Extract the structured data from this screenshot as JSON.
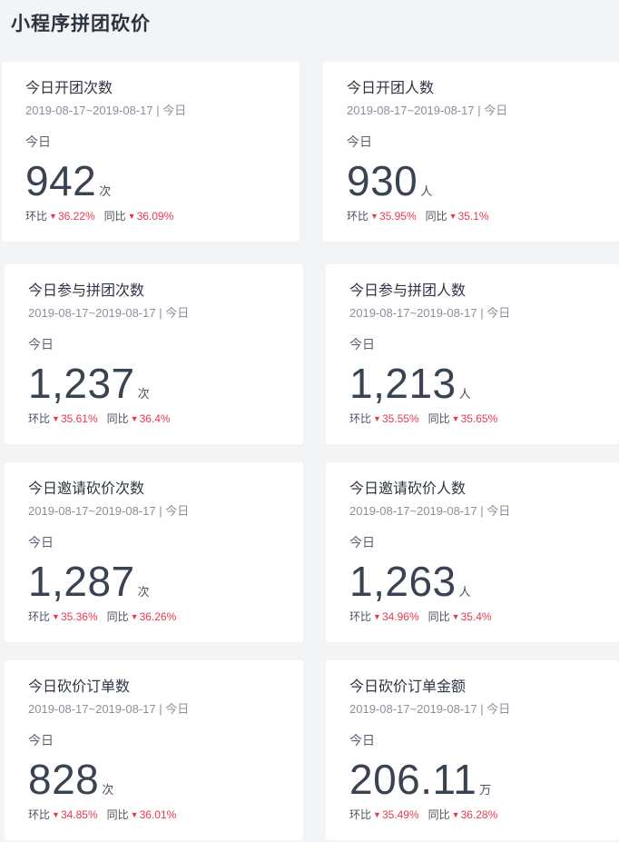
{
  "page": {
    "title": "小程序拼团砍价"
  },
  "colors": {
    "decrease": "#e8384f",
    "background": "#f3f4f6",
    "card": "#ffffff"
  },
  "cards": [
    {
      "title": "今日开团次数",
      "range": "2019-08-17~2019-08-17 | 今日",
      "period": "今日",
      "value": "942",
      "unit": "次",
      "mom_label": "环比",
      "mom_value": "36.22%",
      "yoy_label": "同比",
      "yoy_value": "36.09%"
    },
    {
      "title": "今日开团人数",
      "range": "2019-08-17~2019-08-17 | 今日",
      "period": "今日",
      "value": "930",
      "unit": "人",
      "mom_label": "环比",
      "mom_value": "35.95%",
      "yoy_label": "同比",
      "yoy_value": "35.1%"
    },
    {
      "title": "今日参与拼团次数",
      "range": "2019-08-17~2019-08-17 | 今日",
      "period": "今日",
      "value": "1,237",
      "unit": "次",
      "mom_label": "环比",
      "mom_value": "35.61%",
      "yoy_label": "同比",
      "yoy_value": "36.4%"
    },
    {
      "title": "今日参与拼团人数",
      "range": "2019-08-17~2019-08-17 | 今日",
      "period": "今日",
      "value": "1,213",
      "unit": "人",
      "mom_label": "环比",
      "mom_value": "35.55%",
      "yoy_label": "同比",
      "yoy_value": "35.65%"
    },
    {
      "title": "今日邀请砍价次数",
      "range": "2019-08-17~2019-08-17 | 今日",
      "period": "今日",
      "value": "1,287",
      "unit": "次",
      "mom_label": "环比",
      "mom_value": "35.36%",
      "yoy_label": "同比",
      "yoy_value": "36.26%"
    },
    {
      "title": "今日邀请砍价人数",
      "range": "2019-08-17~2019-08-17 | 今日",
      "period": "今日",
      "value": "1,263",
      "unit": "人",
      "mom_label": "环比",
      "mom_value": "34.96%",
      "yoy_label": "同比",
      "yoy_value": "35.4%"
    },
    {
      "title": "今日砍价订单数",
      "range": "2019-08-17~2019-08-17 | 今日",
      "period": "今日",
      "value": "828",
      "unit": "次",
      "mom_label": "环比",
      "mom_value": "34.85%",
      "yoy_label": "同比",
      "yoy_value": "36.01%"
    },
    {
      "title": "今日砍价订单金额",
      "range": "2019-08-17~2019-08-17 | 今日",
      "period": "今日",
      "value": "206.11",
      "unit": "万",
      "mom_label": "环比",
      "mom_value": "35.49%",
      "yoy_label": "同比",
      "yoy_value": "36.28%"
    }
  ]
}
